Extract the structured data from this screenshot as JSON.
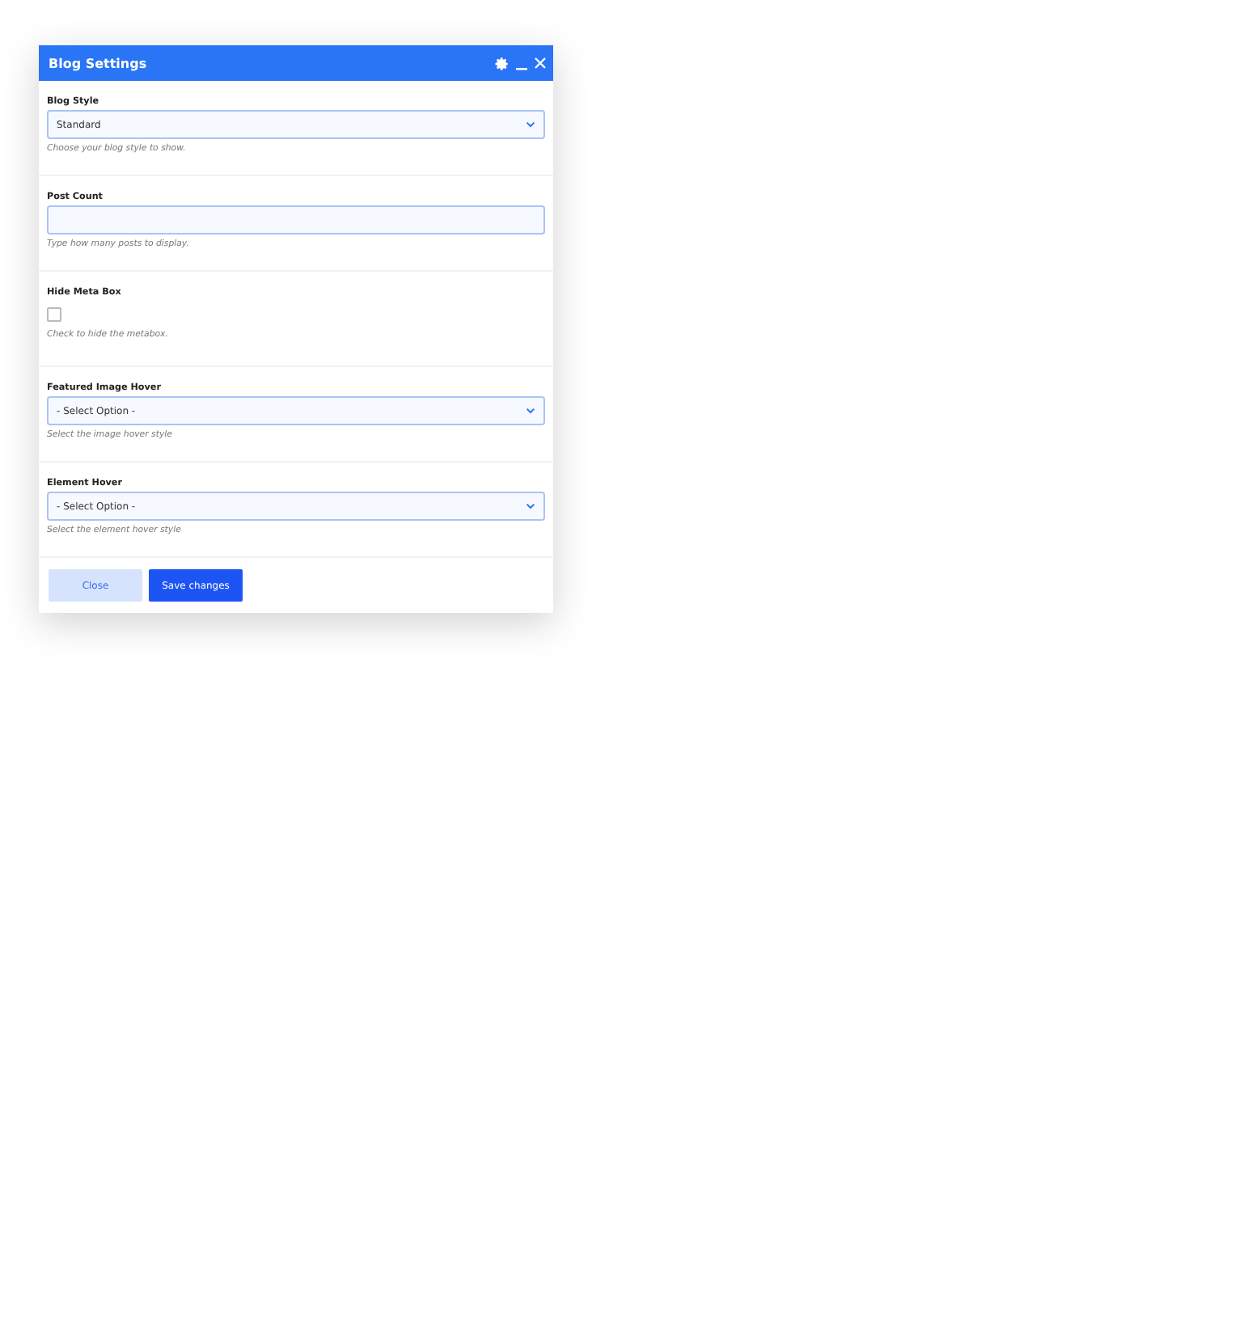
{
  "window": {
    "title": "Blog Settings"
  },
  "fields": [
    {
      "kind": "select",
      "label": "Blog Style",
      "value": "Standard",
      "help": "Choose your blog style to show."
    },
    {
      "kind": "input",
      "label": "Post Count",
      "help": "Type how many posts to display."
    },
    {
      "kind": "checkbox",
      "label": "Hide Meta Box",
      "checked": false,
      "help": "Check to hide the metabox."
    },
    {
      "kind": "select",
      "label": "Featured Image Hover",
      "value": "- Select Option -",
      "help": "Select the image hover style"
    },
    {
      "kind": "select",
      "label": "Element Hover",
      "value": "- Select Option -",
      "help": "Select the element hover style"
    }
  ],
  "buttons": [
    {
      "label": "Close",
      "kind": "secondary"
    },
    {
      "label": "Save changes",
      "kind": "primary"
    }
  ]
}
